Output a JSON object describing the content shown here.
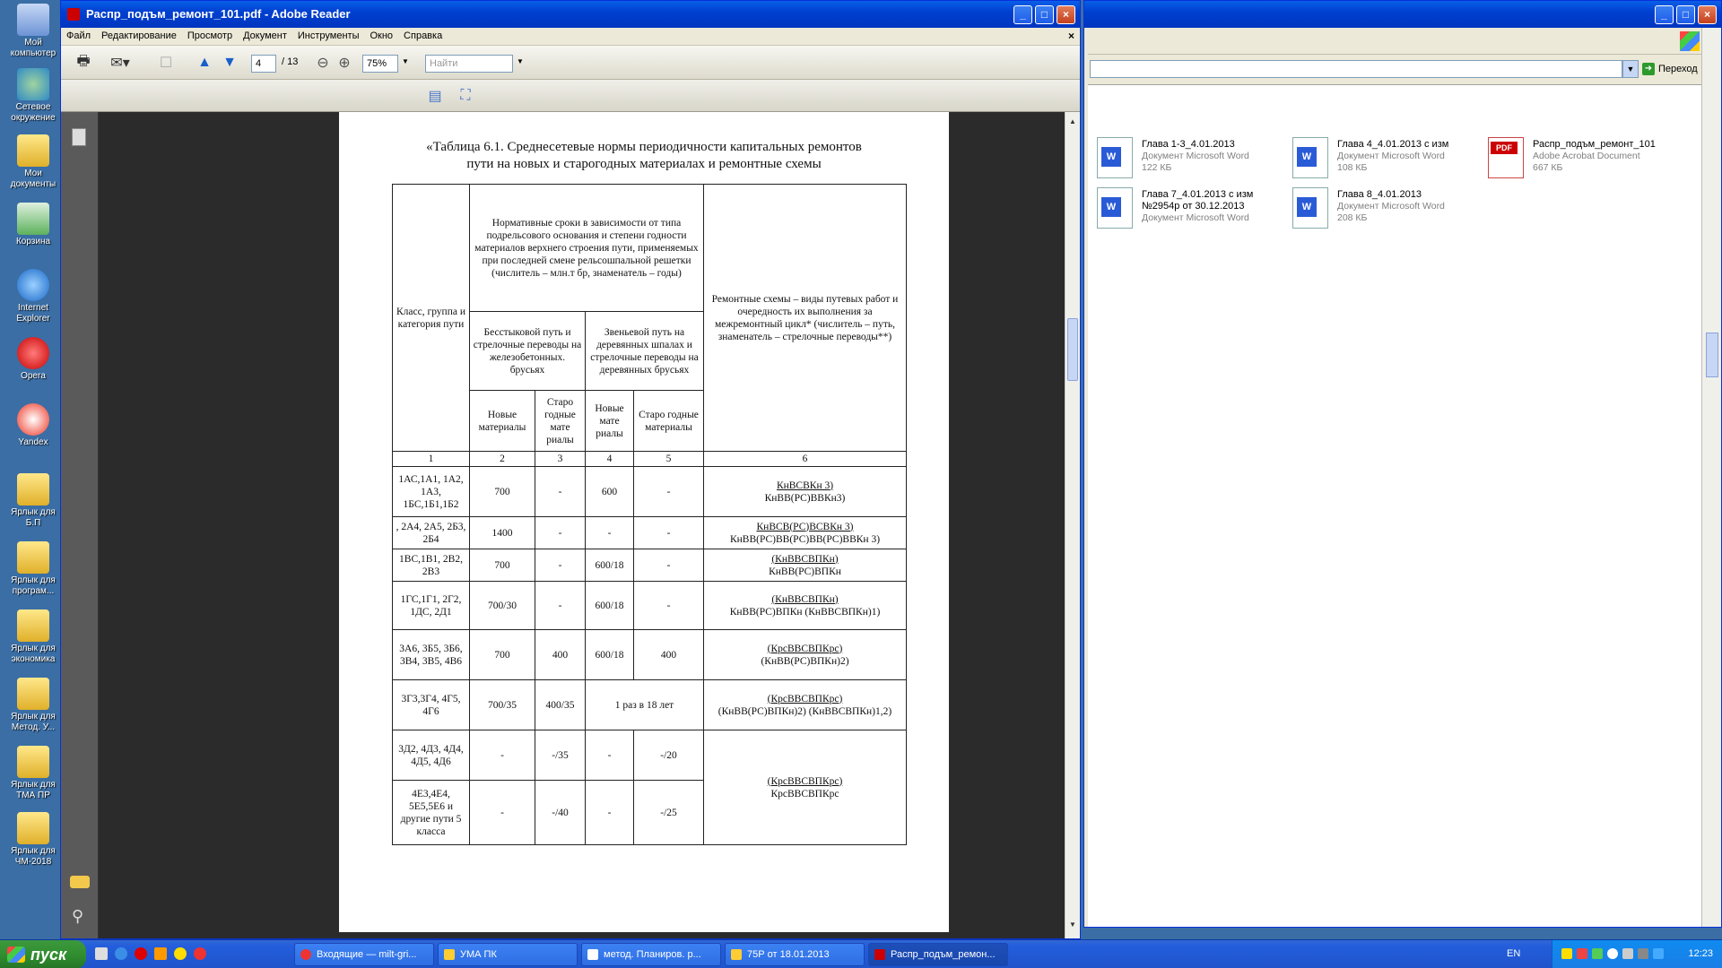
{
  "desktop": {
    "icons": [
      {
        "label": "Мой компьютер"
      },
      {
        "label": "Сетевое окружение"
      },
      {
        "label": "Мои документы"
      },
      {
        "label": "Корзина"
      },
      {
        "label": "Internet Explorer"
      },
      {
        "label": "Opera"
      },
      {
        "label": "Yandex"
      },
      {
        "label": "Ярлык для Б.П"
      },
      {
        "label": "Ярлык для програм..."
      },
      {
        "label": "Ярлык для экономика"
      },
      {
        "label": "Ярлык для Метод. У..."
      },
      {
        "label": "Ярлык для ТМА ПР"
      },
      {
        "label": "Ярлык для ЧМ-2018"
      }
    ]
  },
  "reader": {
    "title": "Распр_подъм_ремонт_101.pdf - Adobe Reader",
    "menu": [
      "Файл",
      "Редактирование",
      "Просмотр",
      "Документ",
      "Инструменты",
      "Окно",
      "Справка"
    ],
    "page_current": "4",
    "page_total": "/ 13",
    "zoom": "75%",
    "search_placeholder": "Найти",
    "caption_line1": "«Таблица 6.1. Среднесетевые нормы периодичности капитальных ремонтов",
    "caption_line2": "пути на новых и старогодных  материалах и ремонтные схемы",
    "table": {
      "h_class": "Класс, группа и категория пути",
      "h_norm": "Нормативные сроки  в зависимости от типа подрельсового основания и степени годности материалов верхнего строения пути, применяемых при последней смене рельсошпальной решетки",
      "h_norm2": "(числитель – млн.т бр, знаменатель – годы)",
      "h_scheme": "Ремонтные схемы – виды путевых работ и очередность их выполнения за межремонтный цикл* (числитель – путь, знаменатель – стрелочные переводы**)",
      "h_jb": "Бесстыковой путь и стрелочные переводы на железобетонных. брусьях",
      "h_wood": "Звеньевой путь на деревянных шпалах и стрелочные переводы на деревянных брусьях",
      "h_new1": "Новые материалы",
      "h_old1": "Старо годные мате риалы",
      "h_new2": "Новые мате риалы",
      "h_old2": "Старо годные материалы",
      "nums": [
        "1",
        "2",
        "3",
        "4",
        "5",
        "6"
      ],
      "rows": [
        {
          "cls": "1АС,1А1, 1А2, 1А3, 1БС,1Б1,1Б2",
          "c2": "700",
          "c3": "-",
          "c4": "600",
          "c5": "-",
          "s1": "КнВСВКн 3)",
          "s2": "КнВВ(РС)ВВКн3)"
        },
        {
          "cls": ", 2А4, 2А5, 2Б3, 2Б4",
          "c2": "1400",
          "c3": "-",
          "c4": "-",
          "c5": "-",
          "s1": "КнВСВ(РС)ВСВКн 3)",
          "s2": "КнВВ(РС)ВВ(РС)ВВ(РС)ВВКн 3)"
        },
        {
          "cls": "1ВС,1В1, 2В2, 2В3",
          "c2": "700",
          "c3": "-",
          "c4": "600/18",
          "c5": "-",
          "s1": "(КнВВСВПКн)",
          "s2": "КнВВ(РС)ВПКн"
        },
        {
          "cls": "1ГС,1Г1, 2Г2, 1ДС, 2Д1",
          "c2": "700/30",
          "c3": "-",
          "c4": "600/18",
          "c5": "-",
          "s1": "(КнВВСВПКн)",
          "s2": "КнВВ(РС)ВПКн (КнВВСВПКн)1)"
        },
        {
          "cls": "3А6, 3Б5, 3Б6, 3В4, 3В5, 4В6",
          "c2": "700",
          "c3": "400",
          "c4": "600/18",
          "c5": "400",
          "s1": "(КрсВВСВПКрс)",
          "s2": "(КнВВ(РС)ВПКн)2)"
        },
        {
          "cls": "3Г3,3Г4, 4Г5, 4Г6",
          "c2": "700/35",
          "c3": "400/35",
          "c45": "1 раз в 18 лет",
          "s1": "(КрсВВСВПКрс)",
          "s2": "(КнВВ(РС)ВПКн)2) (КнВВСВПКн)1,2)"
        },
        {
          "cls": "3Д2, 4Д3, 4Д4, 4Д5, 4Д6",
          "c2": "-",
          "c3": "-/35",
          "c4": "-",
          "c5": "-/20"
        },
        {
          "cls": "4Е3,4Е4, 5Е5,5Е6 и другие пути 5 класса",
          "c2": "-",
          "c3": "-/40",
          "c4": "-",
          "c5": "-/25"
        }
      ],
      "shared_s1": "(КрсВВСВПКрс)",
      "shared_s2": "КрсВВСВПКрс"
    }
  },
  "explorer": {
    "go_label": "Переход",
    "files": [
      {
        "name": "Глава 1-3_4.01.2013",
        "type": "Документ Microsoft Word",
        "size": "122 КБ"
      },
      {
        "name": "Глава 4_4.01.2013 с изм",
        "type": "Документ Microsoft Word",
        "size": "108 КБ"
      },
      {
        "name": "Распр_подъм_ремонт_101",
        "type": "Adobe Acrobat Document",
        "size": "667 КБ"
      },
      {
        "name": "Глава 7_4.01.2013 с изм",
        "name2": "№2954р от 30.12.2013",
        "type": "Документ Microsoft Word"
      },
      {
        "name": "Глава 8_4.01.2013",
        "type": "Документ Microsoft Word",
        "size": "208 КБ"
      }
    ]
  },
  "taskbar": {
    "start": "пуск",
    "buttons": [
      "Входящие — milt-gri...",
      "УМА ПК",
      "метод. Планиров. р...",
      "75Р от 18.01.2013",
      "Распр_подъм_ремон..."
    ],
    "lang": "EN",
    "clock": "12:23"
  }
}
